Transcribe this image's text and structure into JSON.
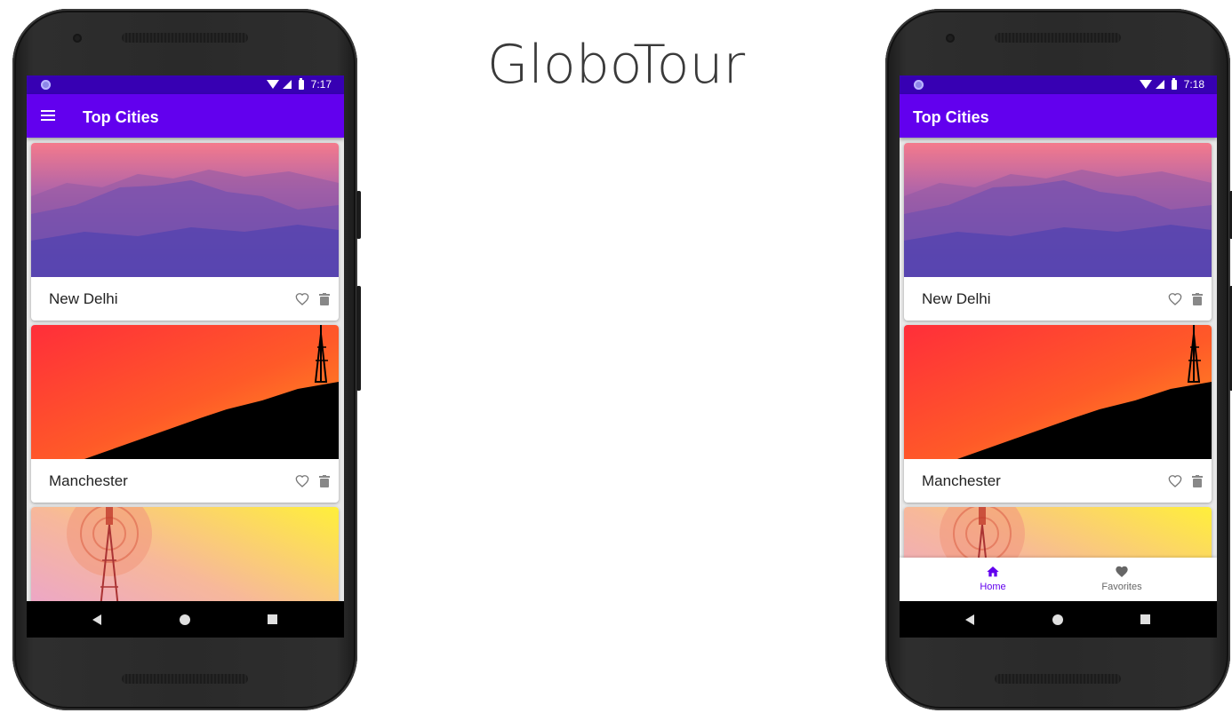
{
  "page_title": "GloboTour",
  "left_phone": {
    "status_time": "7:17",
    "appbar_title": "Top Cities",
    "cities": [
      {
        "name": "New Delhi"
      },
      {
        "name": "Manchester"
      },
      {
        "name": ""
      }
    ]
  },
  "right_phone": {
    "status_time": "7:18",
    "appbar_title": "Top Cities",
    "cities": [
      {
        "name": "New Delhi"
      },
      {
        "name": "Manchester"
      },
      {
        "name": ""
      }
    ],
    "bottom_nav": [
      {
        "label": "Home",
        "icon": "home-icon",
        "active": true
      },
      {
        "label": "Favorites",
        "icon": "heart-filled-icon",
        "active": false
      }
    ]
  },
  "colors": {
    "primary": "#6200ee",
    "primary_dark": "#3700b3",
    "background": "#e8e8e8"
  }
}
